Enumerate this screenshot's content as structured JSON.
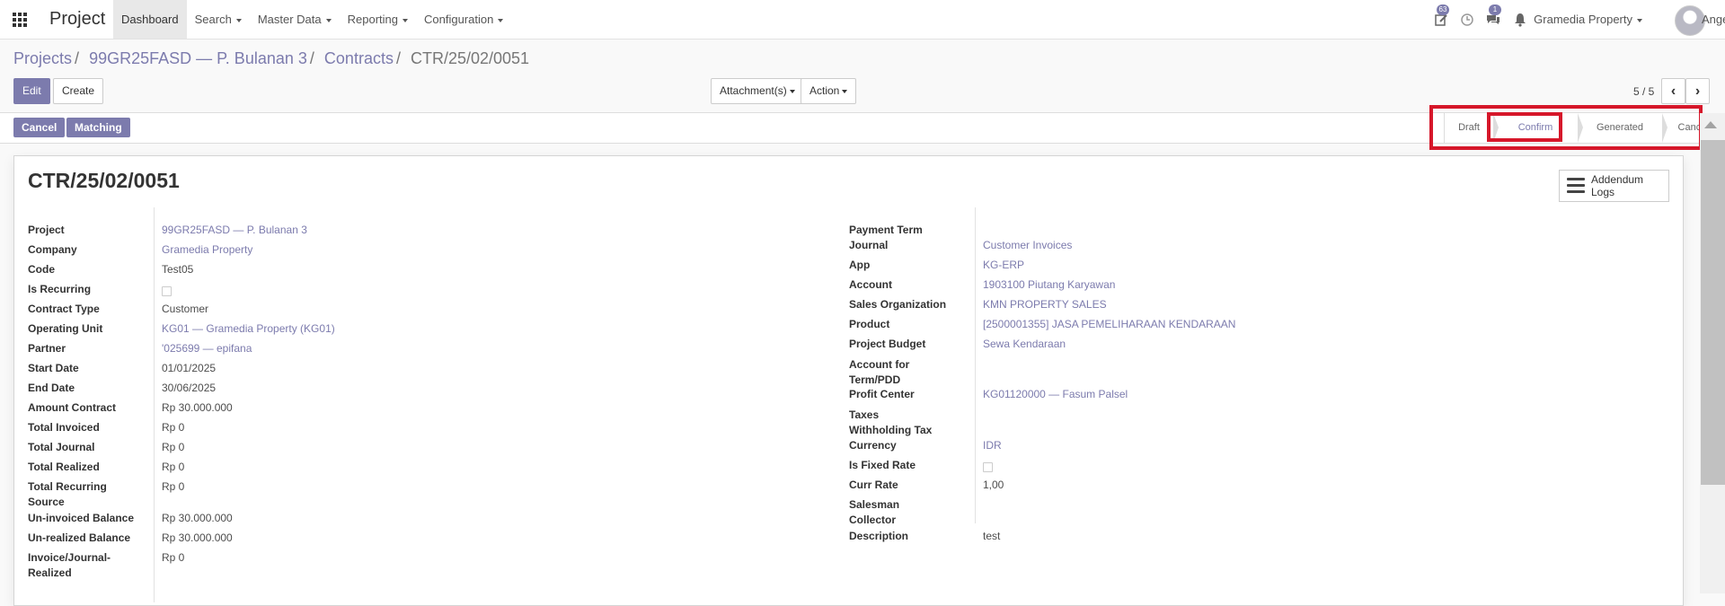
{
  "navbar": {
    "app_name": "Project",
    "menus": [
      {
        "label": "Dashboard",
        "active": true,
        "dropdown": false
      },
      {
        "label": "Search",
        "dropdown": true
      },
      {
        "label": "Master Data",
        "dropdown": true
      },
      {
        "label": "Reporting",
        "dropdown": true
      },
      {
        "label": "Configuration",
        "dropdown": true
      }
    ],
    "activity_badge": "63",
    "messages_badge": "1",
    "company": "Gramedia Property",
    "user": "Angel",
    "icons": [
      "apps-grid-icon",
      "activity-edit-icon",
      "clock-icon",
      "chat-icon",
      "bell-icon"
    ]
  },
  "breadcrumb": {
    "items": [
      "Projects",
      "99GR25FASD — P. Bulanan 3",
      "Contracts"
    ],
    "current": "CTR/25/02/0051"
  },
  "controls": {
    "edit": "Edit",
    "create": "Create",
    "attachments": "Attachment(s)",
    "action": "Action",
    "pager": "5 / 5"
  },
  "statusbar": {
    "cancel": "Cancel",
    "matching": "Matching",
    "stages": [
      "Draft",
      "Confirm",
      "Generated",
      "Cancelled"
    ],
    "current_stage": "Confirm"
  },
  "record": {
    "title": "CTR/25/02/0051",
    "addendum_button": "Addendum Logs",
    "left_fields": [
      {
        "label": "Project",
        "value": "99GR25FASD — P. Bulanan 3",
        "link": true
      },
      {
        "label": "Company",
        "value": "Gramedia Property",
        "link": true
      },
      {
        "label": "Code",
        "value": "Test05"
      },
      {
        "label": "Is Recurring",
        "checkbox": false
      },
      {
        "label": "Contract Type",
        "value": "Customer"
      },
      {
        "label": "Operating Unit",
        "value": "KG01 — Gramedia Property (KG01)",
        "link": true
      },
      {
        "label": "Partner",
        "value": "'025699 — epifana",
        "link": true
      },
      {
        "label": "Start Date",
        "value": "01/01/2025"
      },
      {
        "label": "End Date",
        "value": "30/06/2025"
      },
      {
        "label": "Amount Contract",
        "value": "Rp 30.000.000"
      },
      {
        "label": "Total Invoiced",
        "value": "Rp 0"
      },
      {
        "label": "Total Journal",
        "value": "Rp 0"
      },
      {
        "label": "Total Realized",
        "value": "Rp 0"
      },
      {
        "label": "Total Recurring Source",
        "value": "Rp 0"
      },
      {
        "label": "Un-invoiced Balance",
        "value": "Rp 30.000.000"
      },
      {
        "label": "Un-realized Balance",
        "value": "Rp 30.000.000"
      },
      {
        "label": "Invoice/Journal-Realized",
        "value": "Rp 0"
      }
    ],
    "right_fields": [
      {
        "label": "Payment Term",
        "value": ""
      },
      {
        "label": "Journal",
        "value": "Customer Invoices",
        "link": true
      },
      {
        "label": "App",
        "value": "KG-ERP",
        "link": true
      },
      {
        "label": "Account",
        "value": "1903100 Piutang Karyawan",
        "link": true
      },
      {
        "label": "Sales Organization",
        "value": "KMN PROPERTY SALES",
        "link": true
      },
      {
        "label": "Product",
        "value": "[2500001355] JASA PEMELIHARAAN KENDARAAN",
        "link": true
      },
      {
        "label": "Project Budget",
        "value": "Sewa Kendaraan",
        "link": true
      },
      {
        "label": "Account for Term/PDD",
        "value": ""
      },
      {
        "label": "Profit Center",
        "value": "KG01120000 — Fasum Palsel",
        "link": true
      },
      {
        "label": "Taxes",
        "value": ""
      },
      {
        "label": "Withholding Tax",
        "value": ""
      },
      {
        "label": "Currency",
        "value": "IDR",
        "link": true
      },
      {
        "label": "Is Fixed Rate",
        "checkbox": false
      },
      {
        "label": "Curr Rate",
        "value": "1,00"
      },
      {
        "label": "Salesman",
        "value": ""
      },
      {
        "label": "Collector",
        "value": ""
      },
      {
        "label": "Description",
        "value": "test"
      }
    ]
  },
  "colors": {
    "primary": "#7c7bad",
    "highlight": "#d6172a"
  }
}
